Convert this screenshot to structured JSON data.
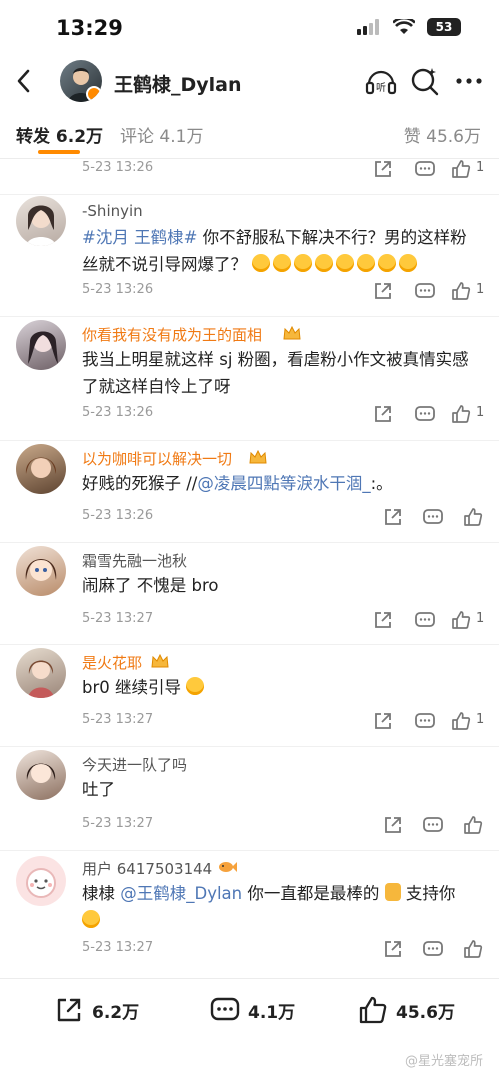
{
  "status_bar": {
    "time": "13:29",
    "battery": "53"
  },
  "header": {
    "title": "王鹤棣_Dylan"
  },
  "tabs": {
    "repost": "转发 6.2万",
    "comment": "评论 4.1万",
    "like": "赞 45.6万"
  },
  "top_item": {
    "time": "5-23 13:26",
    "likes": "1"
  },
  "comments": [
    {
      "user": "-Shinyin",
      "text_tag": "#沈月 王鹤棣#",
      "text": " 你不舒服私下解决不行？男的这样粉丝就不说引导网爆了？",
      "time": "5-23 13:26",
      "likes": "1"
    },
    {
      "user": "你看我有没有成为王的面相",
      "text": "我当上明星就这样 sj 粉圈，看虐粉小作文被真情实感了就这样自怜上了呀",
      "time": "5-23 13:26",
      "likes": "1"
    },
    {
      "user": "以为咖啡可以解决一切",
      "text": "好贱的死猴子 //",
      "mention": "@凌晨四點等淚水干涸_",
      "text_after": ":。",
      "time": "5-23 13:26"
    },
    {
      "user": "霜雪先融一池秋",
      "text": "闹麻了 不愧是 bro",
      "time": "5-23 13:27",
      "likes": "1"
    },
    {
      "user": "是火花耶",
      "text": "br0 继续引导",
      "time": "5-23 13:27",
      "likes": "1"
    },
    {
      "user": "今天进一队了吗",
      "text": "吐了",
      "time": "5-23 13:27"
    },
    {
      "user": "用户 6417503144",
      "text": "棣棣 ",
      "mention": "@王鹤棣_Dylan",
      "text_after": " 你一直都是最棒的",
      "text_end": " 支持你",
      "time": "5-23 13:27"
    }
  ],
  "bottom_bar": {
    "repost": "6.2万",
    "comment": "4.1万",
    "like": "45.6万"
  },
  "watermark": "@星光塞宠所",
  "colors": {
    "accent": "#ff8a00",
    "link": "#4f77b5",
    "vip_name": "#f07a14"
  }
}
